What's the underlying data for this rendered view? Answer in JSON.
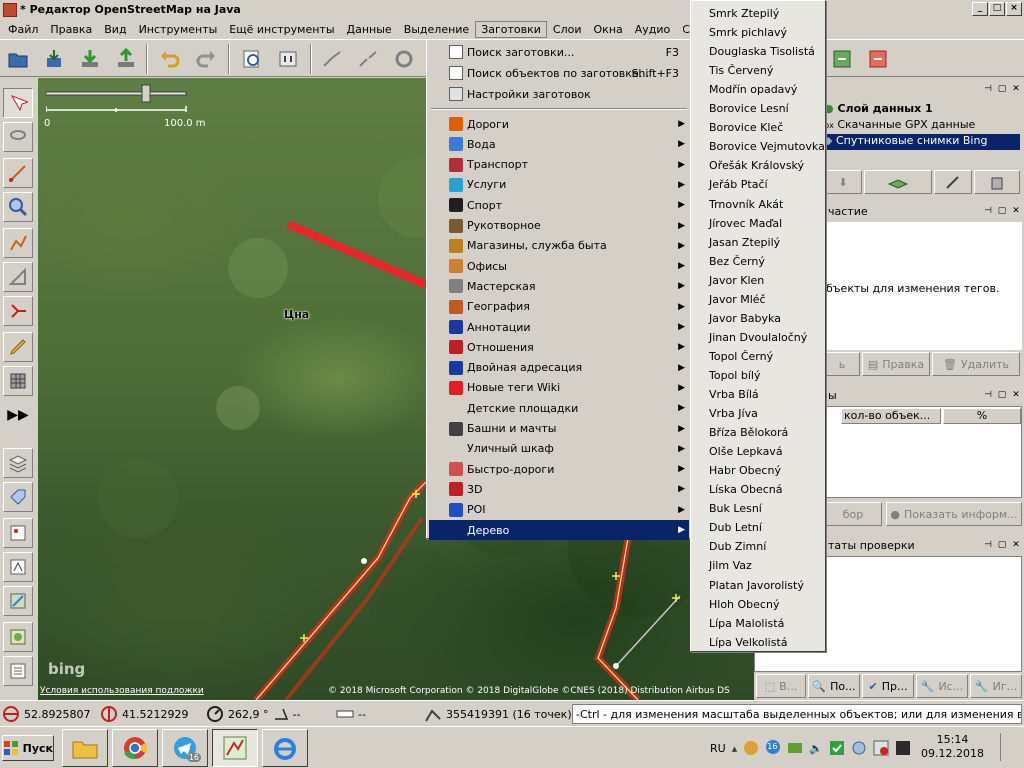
{
  "window": {
    "title": "* Редактор OpenStreetMap на Java",
    "buttons": [
      "_",
      "□",
      "×"
    ]
  },
  "menubar": [
    "Файл",
    "Правка",
    "Вид",
    "Инструменты",
    "Ещё инструменты",
    "Данные",
    "Выделение",
    "Заготовки",
    "Слои",
    "Окна",
    "Аудио",
    "Справка"
  ],
  "presets_menu": {
    "top_items": [
      {
        "label": "Поиск заготовки...",
        "shortcut": "F3",
        "icon": "search-preset-icon"
      },
      {
        "label": "Поиск объектов по заготовке...",
        "shortcut": "Shift+F3",
        "icon": "search-objects-icon"
      },
      {
        "label": "Настройки заготовок",
        "shortcut": "",
        "icon": "preset-settings-icon"
      }
    ],
    "groups": [
      {
        "label": "Дороги",
        "icon": "roads-icon",
        "color": "#e06000"
      },
      {
        "label": "Вода",
        "icon": "water-icon",
        "color": "#3a7bd5"
      },
      {
        "label": "Транспорт",
        "icon": "transport-icon",
        "color": "#b0303a"
      },
      {
        "label": "Услуги",
        "icon": "services-icon",
        "color": "#2aa0d0"
      },
      {
        "label": "Спорт",
        "icon": "sport-icon",
        "color": "#202020"
      },
      {
        "label": "Рукотворное",
        "icon": "man-made-icon",
        "color": "#7a5a30"
      },
      {
        "label": "Магазины, служба быта",
        "icon": "shops-icon",
        "color": "#c08020"
      },
      {
        "label": "Офисы",
        "icon": "offices-icon",
        "color": "#d08030"
      },
      {
        "label": "Мастерская",
        "icon": "craft-icon",
        "color": "#808080"
      },
      {
        "label": "География",
        "icon": "geography-icon",
        "color": "#c05a20"
      },
      {
        "label": "Аннотации",
        "icon": "annotations-icon",
        "color": "#1a3aa0"
      },
      {
        "label": "Отношения",
        "icon": "relations-icon",
        "color": "#c02020"
      },
      {
        "label": "Двойная адресация",
        "icon": "double-address-icon",
        "color": "#1a3aa0"
      },
      {
        "label": "Новые теги Wiki",
        "icon": "new-wiki-tags-icon",
        "color": "#e02020"
      },
      {
        "label": "Детские площадки",
        "icon": "",
        "color": ""
      },
      {
        "label": "Башни и мачты",
        "icon": "towers-icon",
        "color": "#404040"
      },
      {
        "label": "Уличный шкаф",
        "icon": "",
        "color": ""
      },
      {
        "label": "Быстро-дороги",
        "icon": "quick-roads-icon",
        "color": "#d05050"
      },
      {
        "label": "3D",
        "icon": "3d-icon",
        "color": "#c02020"
      },
      {
        "label": "POI",
        "icon": "poi-icon",
        "color": "#2050c0"
      },
      {
        "label": "Дерево",
        "icon": "",
        "color": ""
      }
    ],
    "highlighted": "Дерево"
  },
  "tree_submenu": [
    "Smrk Ztepilý",
    "Smrk pichlavý",
    "Douglaska Tisolistá",
    "Tis Červený",
    "Modřín opadavý",
    "Borovice Lesní",
    "Borovice Kleč",
    "Borovice Vejmutovka",
    "Ořešák Královský",
    "Jeřáb Ptačí",
    "Trnovník Akát",
    "Jírovec Maďal",
    "Jasan Ztepilý",
    "Bez Černý",
    "Javor Klen",
    "Javor Mléč",
    "Javor Babyka",
    "Jinan Dvoulaločný",
    "Topol Černý",
    "Topol bílý",
    "Vrba Bílá",
    "Vrba Jíva",
    "Bříza Bělokorá",
    "Olše Lepkavá",
    "Habr Obecný",
    "Líska Obecná",
    "Buk Lesní",
    "Dub Letní",
    "Dub Zimní",
    "Jilm Vaz",
    "Platan Javorolistý",
    "Hloh Obecný",
    "Lípa Malolistá",
    "Lípa Velkolistá"
  ],
  "map": {
    "scale_start": "0",
    "scale_end": "100.0 m",
    "place_label": "Цна",
    "bing_logo": "bing",
    "terms_link": "Условия использования подложки",
    "copyright": "© 2018 Microsoft Corporation © 2018 DigitalGlobe ©CNES (2018) Distribution Airbus DS",
    "arrow_color": "#e8262a",
    "road_color": "#c83018"
  },
  "right_panel": {
    "layers": [
      {
        "label": "Слой данных 1",
        "icon": "data-layer-icon"
      },
      {
        "label": "Скачанные GPX данные",
        "icon": "gpx-icon"
      },
      {
        "label": "Спутниковые снимки Bing",
        "icon": "bing-layer-icon"
      }
    ],
    "selected_layer": "Спутниковые снимки Bing",
    "tags_title": "частие",
    "tags_hint": "бъекты для изменения тегов.",
    "tags_buttons": [
      "ь",
      "Правка",
      "Удалить"
    ],
    "relations_title": "ы",
    "relations_columns": [
      "кол-во объек...",
      "%"
    ],
    "relations_buttons": [
      "бор",
      "Показать информ..."
    ],
    "validation_title": "таты проверки",
    "validation_buttons": [
      "В...",
      "По...",
      "Пр...",
      "Ис...",
      "Иг..."
    ]
  },
  "statusbar": {
    "lat": "52.8925807",
    "lon": "41.5212929",
    "heading": "262,9 °",
    "angle": "--",
    "distance": "--",
    "object": "355419391 (16 точек)",
    "help": "-Ctrl - для изменения масштаба выделенных объектов; или для изменения выделения"
  },
  "taskbar": {
    "start": "Пуск",
    "language": "RU",
    "time": "15:14",
    "date": "09.12.2018",
    "telegram_badge": "16",
    "tray_badge": "16"
  }
}
